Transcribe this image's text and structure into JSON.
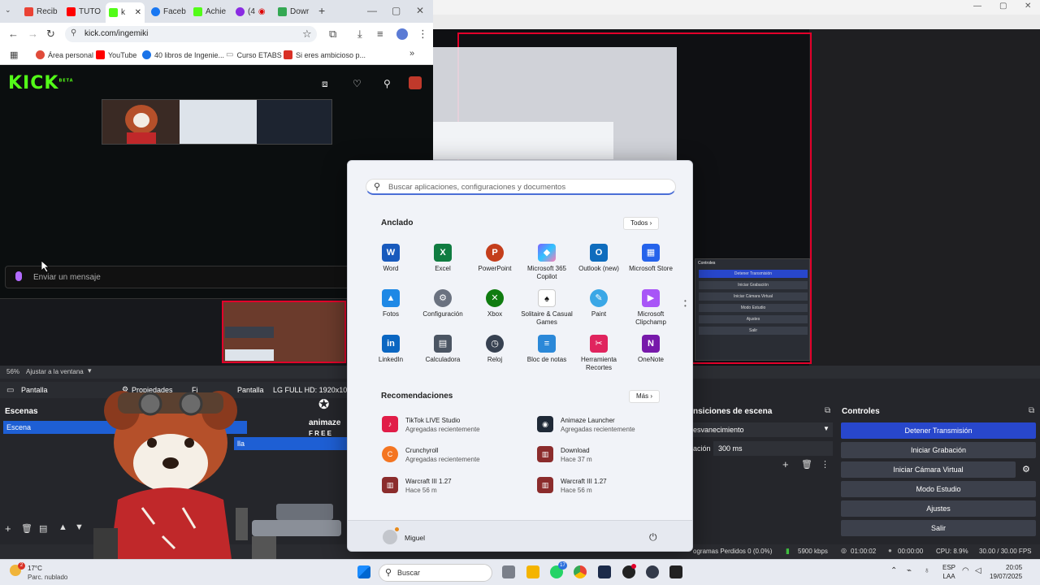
{
  "browser": {
    "tabs": [
      {
        "label": "Recib",
        "color": "#ea4335",
        "icon": "gmail-icon"
      },
      {
        "label": "TUTO",
        "color": "#ff0000",
        "icon": "youtube-icon"
      },
      {
        "label": "",
        "color": "#53fc18",
        "icon": "kick-icon"
      },
      {
        "label": "Faceb",
        "color": "#1877f2",
        "icon": "facebook-icon"
      },
      {
        "label": "Achie",
        "color": "#53fc18",
        "icon": "kick-icon"
      },
      {
        "label": "(4",
        "color": "#8a2be2",
        "icon": "twitch-icon"
      },
      {
        "label": "Dowr",
        "color": "#34a853",
        "icon": "drive-icon"
      }
    ],
    "url": "kick.com/ingemiki",
    "bookmarks": [
      {
        "label": "Área personal",
        "color": "#e04b3a"
      },
      {
        "label": "YouTube",
        "color": "#ff0000"
      },
      {
        "label": "40 libros de Ingenie...",
        "color": "#1a73e8"
      },
      {
        "label": "Curso ETABS",
        "color": "#888888"
      },
      {
        "label": "Si eres ambicioso p...",
        "color": "#d93025"
      }
    ]
  },
  "kick": {
    "logo": "KICK",
    "beta": "BETA",
    "chat_placeholder": "Enviar un mensaje"
  },
  "obs": {
    "zoom": "56%",
    "fit_label": "Ajustar a la ventana",
    "source_label": "Pantalla",
    "properties_label": "Propiedades",
    "filters_label": "Fi",
    "source_label_2": "Pantalla",
    "monitor_label": "LG FULL HD: 1920x1080",
    "scenes_title": "Escenas",
    "scene_item": "Escena",
    "transitions_title": "nsiciones de escena",
    "transition_type": "esvanecimiento",
    "duration_label": "ación",
    "duration_value": "300 ms",
    "controls_title": "Controles",
    "controls": [
      "Detener Transmisión",
      "Iniciar Grabación",
      "Iniciar Cámara Virtual",
      "Modo Estudio",
      "Ajustes",
      "Salir"
    ],
    "mini_controls_title": "Controles",
    "footer": {
      "frames": "ogramas Perdidos 0 (0.0%)",
      "bitrate": "5900 kbps",
      "live_time": "01:00:02",
      "rec_time": "00:00:00",
      "cpu": "CPU: 8.9%",
      "fps": "30.00 / 30.00 FPS"
    },
    "animaze": "animaze",
    "animaze_free": "F R E E"
  },
  "start_menu": {
    "search_placeholder": "Buscar aplicaciones, configuraciones y documentos",
    "pinned_title": "Anclado",
    "all_button": "Todos",
    "apps": [
      {
        "name": "Word",
        "color": "#185abd",
        "glyph": "W"
      },
      {
        "name": "Excel",
        "color": "#107c41",
        "glyph": "X"
      },
      {
        "name": "PowerPoint",
        "color": "#c43e1c",
        "glyph": "P"
      },
      {
        "name": "Microsoft 365 Copilot",
        "color": "#7b61ff",
        "glyph": "◆"
      },
      {
        "name": "Outlook (new)",
        "color": "#0f6cbd",
        "glyph": "O"
      },
      {
        "name": "Microsoft Store",
        "color": "#2563eb",
        "glyph": "▦"
      },
      {
        "name": "Fotos",
        "color": "#1e88e5",
        "glyph": "▲"
      },
      {
        "name": "Configuración",
        "color": "#6b7280",
        "glyph": "⚙"
      },
      {
        "name": "Xbox",
        "color": "#107c10",
        "glyph": "✕"
      },
      {
        "name": "Solitaire & Casual Games",
        "color": "#3b3b3b",
        "glyph": "♠"
      },
      {
        "name": "Paint",
        "color": "#3aa7e6",
        "glyph": "✎"
      },
      {
        "name": "Microsoft Clipchamp",
        "color": "#a855f7",
        "glyph": "▶"
      },
      {
        "name": "LinkedIn",
        "color": "#0a66c2",
        "glyph": "in"
      },
      {
        "name": "Calculadora",
        "color": "#4b5563",
        "glyph": "▤"
      },
      {
        "name": "Reloj",
        "color": "#374151",
        "glyph": "◷"
      },
      {
        "name": "Bloc de notas",
        "color": "#2b88d8",
        "glyph": "≡"
      },
      {
        "name": "Herramienta Recortes",
        "color": "#e0245e",
        "glyph": "✂"
      },
      {
        "name": "OneNote",
        "color": "#7719aa",
        "glyph": "N"
      }
    ],
    "rec_title": "Recomendaciones",
    "more_button": "Más",
    "recommendations": [
      {
        "name": "TikTok LIVE Studio",
        "sub": "Agregadas recientemente",
        "color": "#e11d48",
        "glyph": "♪"
      },
      {
        "name": "Animaze Launcher",
        "sub": "Agregadas recientemente",
        "color": "#1f2937",
        "glyph": "◉"
      },
      {
        "name": "Crunchyroll",
        "sub": "Agregadas recientemente",
        "color": "#f47521",
        "glyph": "C"
      },
      {
        "name": "Download",
        "sub": "Hace 37 m",
        "color": "#8b2c2c",
        "glyph": "▥"
      },
      {
        "name": "Warcraft III 1.27",
        "sub": "Hace 56 m",
        "color": "#8b2c2c",
        "glyph": "▥"
      },
      {
        "name": "Warcraft III 1.27",
        "sub": "Hace 56 m",
        "color": "#8b2c2c",
        "glyph": "▥"
      }
    ],
    "user": "Miguel"
  },
  "taskbar": {
    "temperature": "17°C",
    "weather": "Parc. nublado",
    "weather_badge": "2",
    "search": "Buscar",
    "whatsapp_badge": "17",
    "lang": "ESP",
    "lang_sub": "LAA",
    "time": "20:05",
    "date": "19/07/2025"
  }
}
